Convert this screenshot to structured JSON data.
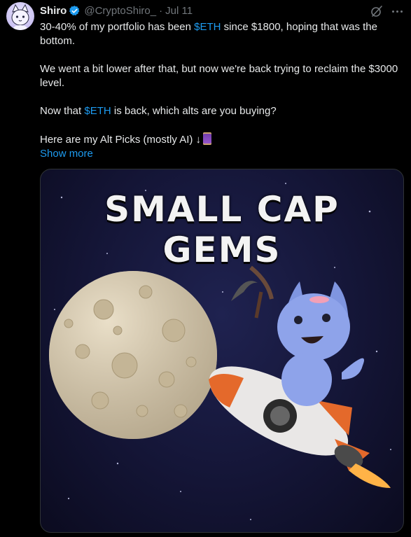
{
  "author": {
    "name": "Shiro",
    "handle": "@CryptoShiro_",
    "separator": "·",
    "date": "Jul 11"
  },
  "tweet": {
    "line1_a": "30-40% of my portfolio has been ",
    "line1_cashtag": "$ETH",
    "line1_b": " since $1800, hoping that was the bottom.",
    "para2": "We went a bit lower after that, but now we're back trying to reclaim the $3000 level.",
    "para3_a": "Now that ",
    "para3_cashtag": "$ETH",
    "para3_b": " is back, which alts are you buying?",
    "para4": "Here are my Alt Picks (mostly AI) ↓",
    "show_more": "Show more"
  },
  "media": {
    "title_line1": "SMALL CAP",
    "title_line2": "GEMS"
  },
  "icons": {
    "verified": "verified-badge-icon",
    "grok": "grok-icon",
    "more": "more-options-icon"
  },
  "colors": {
    "background": "#000000",
    "link": "#1d9bf0",
    "muted": "#71767b",
    "text": "#e7e9ea"
  }
}
